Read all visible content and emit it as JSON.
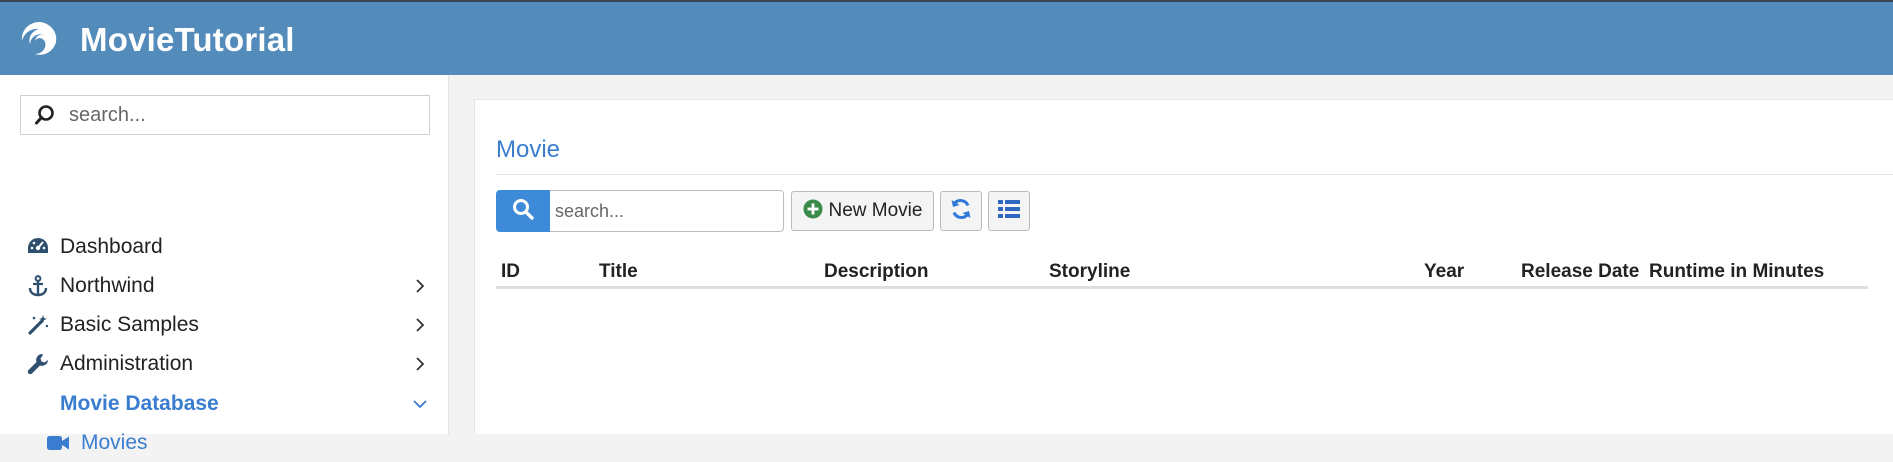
{
  "app": {
    "title": "MovieTutorial",
    "logo_icon": "serenity-logo-icon"
  },
  "sidebar": {
    "search_placeholder": "search...",
    "items": [
      {
        "label": "Dashboard",
        "icon": "dashboard-icon",
        "chevron": ""
      },
      {
        "label": "Northwind",
        "icon": "anchor-icon",
        "chevron": "right"
      },
      {
        "label": "Basic Samples",
        "icon": "magic-wand-icon",
        "chevron": "right"
      },
      {
        "label": "Administration",
        "icon": "wrench-icon",
        "chevron": "right"
      },
      {
        "label": "Movie Database",
        "icon": "",
        "chevron": "down",
        "active": true
      },
      {
        "label": "Movies",
        "icon": "video-camera-icon",
        "chevron": ""
      }
    ]
  },
  "main": {
    "title": "Movie",
    "search_placeholder": "search...",
    "new_button_label": "New Movie",
    "columns": [
      "ID",
      "Title",
      "Description",
      "Storyline",
      "Year",
      "Release Date",
      "Runtime in Minutes"
    ]
  },
  "colors": {
    "topbar": "#538bba",
    "accent": "#3a7dd0",
    "search_button": "#3d8bd8",
    "add_icon": "#3a8a4a"
  }
}
